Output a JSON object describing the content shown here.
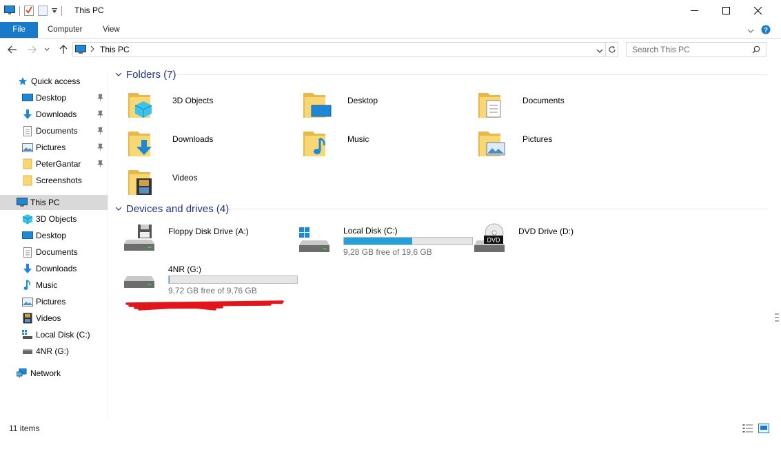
{
  "window": {
    "title": "This PC",
    "controls": [
      "minimize",
      "maximize",
      "close"
    ]
  },
  "ribbon": {
    "tabs": [
      {
        "label": "File",
        "active": true
      },
      {
        "label": "Computer"
      },
      {
        "label": "View"
      }
    ]
  },
  "address": {
    "breadcrumb": [
      "This PC"
    ],
    "search_placeholder": "Search This PC"
  },
  "sidebar": {
    "quick_access": {
      "label": "Quick access",
      "icon": "star-icon"
    },
    "quick_items": [
      {
        "label": "Desktop",
        "icon": "desktop-icon",
        "pinned": true
      },
      {
        "label": "Downloads",
        "icon": "download-arrow-icon",
        "pinned": true
      },
      {
        "label": "Documents",
        "icon": "document-icon",
        "pinned": true
      },
      {
        "label": "Pictures",
        "icon": "picture-icon",
        "pinned": true
      },
      {
        "label": "PeterGantar",
        "icon": "folder-icon",
        "pinned": true
      },
      {
        "label": "Screenshots",
        "icon": "folder-icon",
        "pinned": false
      }
    ],
    "this_pc": {
      "label": "This PC",
      "icon": "computer-icon",
      "selected": true
    },
    "pc_items": [
      {
        "label": "3D Objects",
        "icon": "cube-icon"
      },
      {
        "label": "Desktop",
        "icon": "desktop-icon"
      },
      {
        "label": "Documents",
        "icon": "document-icon"
      },
      {
        "label": "Downloads",
        "icon": "download-arrow-icon"
      },
      {
        "label": "Music",
        "icon": "music-note-icon"
      },
      {
        "label": "Pictures",
        "icon": "picture-icon"
      },
      {
        "label": "Videos",
        "icon": "film-icon"
      },
      {
        "label": "Local Disk (C:)",
        "icon": "windows-drive-icon"
      },
      {
        "label": "4NR (G:)",
        "icon": "usb-drive-icon"
      }
    ],
    "network": {
      "label": "Network",
      "icon": "network-icon"
    }
  },
  "folders": {
    "header": "Folders (7)",
    "items": [
      {
        "label": "3D Objects",
        "icon": "cube-icon"
      },
      {
        "label": "Desktop",
        "icon": "desktop-icon"
      },
      {
        "label": "Documents",
        "icon": "document-icon"
      },
      {
        "label": "Downloads",
        "icon": "download-arrow-icon"
      },
      {
        "label": "Music",
        "icon": "music-note-icon"
      },
      {
        "label": "Pictures",
        "icon": "picture-icon"
      },
      {
        "label": "Videos",
        "icon": "film-icon"
      }
    ]
  },
  "drives": {
    "header": "Devices and drives (4)",
    "items": [
      {
        "label": "Floppy Disk Drive (A:)",
        "icon": "floppy-drive-icon"
      },
      {
        "label": "Local Disk (C:)",
        "icon": "windows-drive-icon",
        "free_text": "9,28 GB free of 19,6 GB",
        "used_fraction": 0.53
      },
      {
        "label": "DVD Drive (D:)",
        "icon": "dvd-drive-icon",
        "badge": "DVD"
      },
      {
        "label": "4NR (G:)",
        "icon": "usb-drive-icon",
        "free_text": "9,72 GB free of 9,76 GB",
        "used_fraction": 0.004
      }
    ]
  },
  "status": {
    "item_count": "11 items"
  },
  "colors": {
    "accent": "#1979ca",
    "group_header": "#1e3287",
    "progress": "#26a0da",
    "selection": "#d9d9d9",
    "redaction": "#e0161b"
  }
}
